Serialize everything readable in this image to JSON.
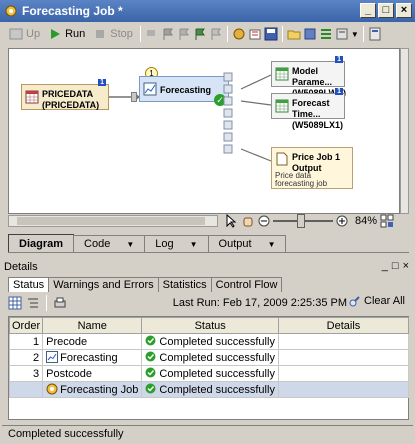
{
  "window": {
    "title": "Forecasting Job *"
  },
  "toolbar": {
    "up_label": "Up",
    "run_label": "Run",
    "stop_label": "Stop"
  },
  "diagram": {
    "pricedata_label_1": "PRICEDATA",
    "pricedata_label_2": "(PRICEDATA)",
    "forecasting_label": "Forecasting",
    "model_param_label_1": "Model Parame...",
    "model_param_label_2": "(W5089LWX)",
    "forecast_time_label_1": "Forecast Time...",
    "forecast_time_label_2": "(W5089LX1)",
    "price_job_label_1": "Price Job 1",
    "price_job_label_2": "Output",
    "price_job_desc": "Price data forecasting job",
    "badge_one": "1",
    "zoom": "84%"
  },
  "tabs": [
    {
      "label": "Diagram",
      "active": true
    },
    {
      "label": "Code",
      "active": false
    },
    {
      "label": "Log",
      "active": false
    },
    {
      "label": "Output",
      "active": false
    }
  ],
  "details": {
    "title": "Details",
    "tabs": [
      "Status",
      "Warnings and Errors",
      "Statistics",
      "Control Flow"
    ],
    "last_run": "Last Run: Feb 17, 2009 2:25:35 PM",
    "clear_all": "Clear All",
    "columns": [
      "Order",
      "Name",
      "Status",
      "Details"
    ],
    "rows": [
      {
        "order": "1",
        "name": "Precode",
        "status": "Completed successfully",
        "details": ""
      },
      {
        "order": "2",
        "name": "Forecasting",
        "status": "Completed successfully",
        "details": ""
      },
      {
        "order": "3",
        "name": "Postcode",
        "status": "Completed successfully",
        "details": ""
      },
      {
        "order": "",
        "name": "Forecasting Job",
        "status": "Completed successfully",
        "details": ""
      }
    ]
  },
  "statusbar": {
    "text": "Completed successfully"
  }
}
